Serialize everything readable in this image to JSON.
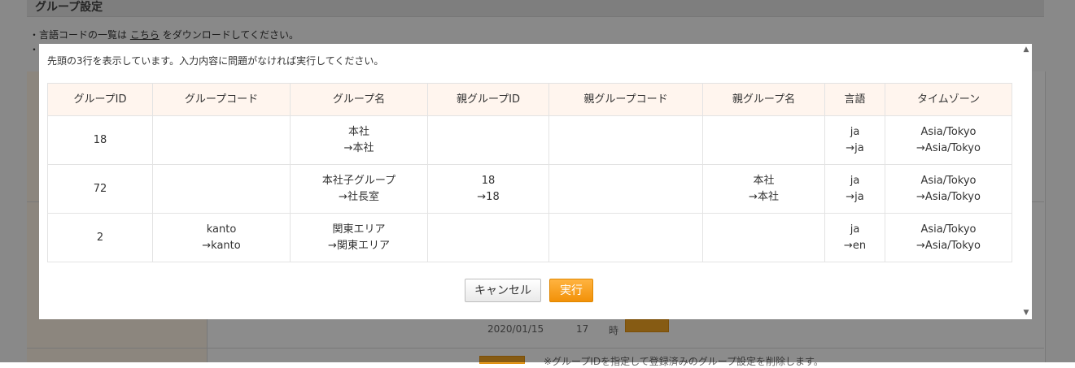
{
  "background": {
    "header_title": "グループ設定",
    "note_prefix": "・言語コードの一覧は",
    "note_link": "こちら",
    "note_suffix": "をダウンロードしてください。",
    "note2": "・",
    "footer_note": "※グループIDを指定して登録済みのグループ設定を削除します。",
    "date_fragment": "2020/01/15",
    "time_fragment": "17",
    "hour_label": "時"
  },
  "modal": {
    "message": "先頭の3行を表示しています。入力内容に問題がなければ実行してください。",
    "columns": [
      "グループID",
      "グループコード",
      "グループ名",
      "親グループID",
      "親グループコード",
      "親グループ名",
      "言語",
      "タイムゾーン"
    ],
    "rows": [
      [
        [
          "18"
        ],
        [],
        [
          "本社",
          "→本社"
        ],
        [],
        [],
        [],
        [
          "ja",
          "→ja"
        ],
        [
          "Asia/Tokyo",
          "→Asia/Tokyo"
        ]
      ],
      [
        [
          "72"
        ],
        [],
        [
          "本社子グループ",
          "→社長室"
        ],
        [
          "18",
          "→18"
        ],
        [],
        [
          "本社",
          "→本社"
        ],
        [
          "ja",
          "→ja"
        ],
        [
          "Asia/Tokyo",
          "→Asia/Tokyo"
        ]
      ],
      [
        [
          "2"
        ],
        [
          "kanto",
          "→kanto"
        ],
        [
          "関東エリア",
          "→関東エリア"
        ],
        [],
        [],
        [],
        [
          "ja",
          "→en"
        ],
        [
          "Asia/Tokyo",
          "→Asia/Tokyo"
        ]
      ]
    ],
    "cancel_label": "キャンセル",
    "execute_label": "実行"
  },
  "colors": {
    "header_bg": "#fff5ee",
    "execute_bg": "#f5a623",
    "overlay": "rgba(0,0,0,0.45)"
  },
  "icons": {
    "scroll_up": "triangle-up",
    "scroll_down": "triangle-down"
  }
}
